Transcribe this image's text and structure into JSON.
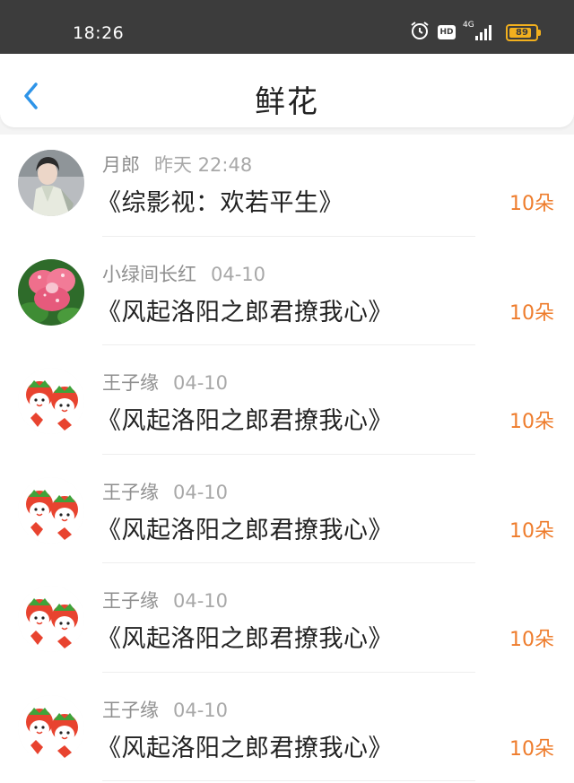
{
  "status_bar": {
    "time": "18:26",
    "hd_label": "HD",
    "network": "4G",
    "battery": "89",
    "icons": [
      "alarm-icon",
      "hd-icon",
      "signal-icon",
      "battery-icon"
    ]
  },
  "header": {
    "title": "鲜花",
    "back_icon": "chevron-left-icon",
    "accent_color": "#2e94e8"
  },
  "colors": {
    "count": "#ee7c2c"
  },
  "entries": [
    {
      "user": "月郎",
      "date": "昨天 22:48",
      "book": "《综影视：欢若平生》",
      "count": "10朵",
      "avatar": "portrait-avatar"
    },
    {
      "user": "小绿间长红",
      "date": "04-10",
      "book": "《风起洛阳之郎君撩我心》",
      "count": "10朵",
      "avatar": "flower-avatar"
    },
    {
      "user": "王子缘",
      "date": "04-10",
      "book": "《风起洛阳之郎君撩我心》",
      "count": "10朵",
      "avatar": "strawberry-cartoon-avatar"
    },
    {
      "user": "王子缘",
      "date": "04-10",
      "book": "《风起洛阳之郎君撩我心》",
      "count": "10朵",
      "avatar": "strawberry-cartoon-avatar"
    },
    {
      "user": "王子缘",
      "date": "04-10",
      "book": "《风起洛阳之郎君撩我心》",
      "count": "10朵",
      "avatar": "strawberry-cartoon-avatar"
    },
    {
      "user": "王子缘",
      "date": "04-10",
      "book": "《风起洛阳之郎君撩我心》",
      "count": "10朵",
      "avatar": "strawberry-cartoon-avatar"
    }
  ]
}
